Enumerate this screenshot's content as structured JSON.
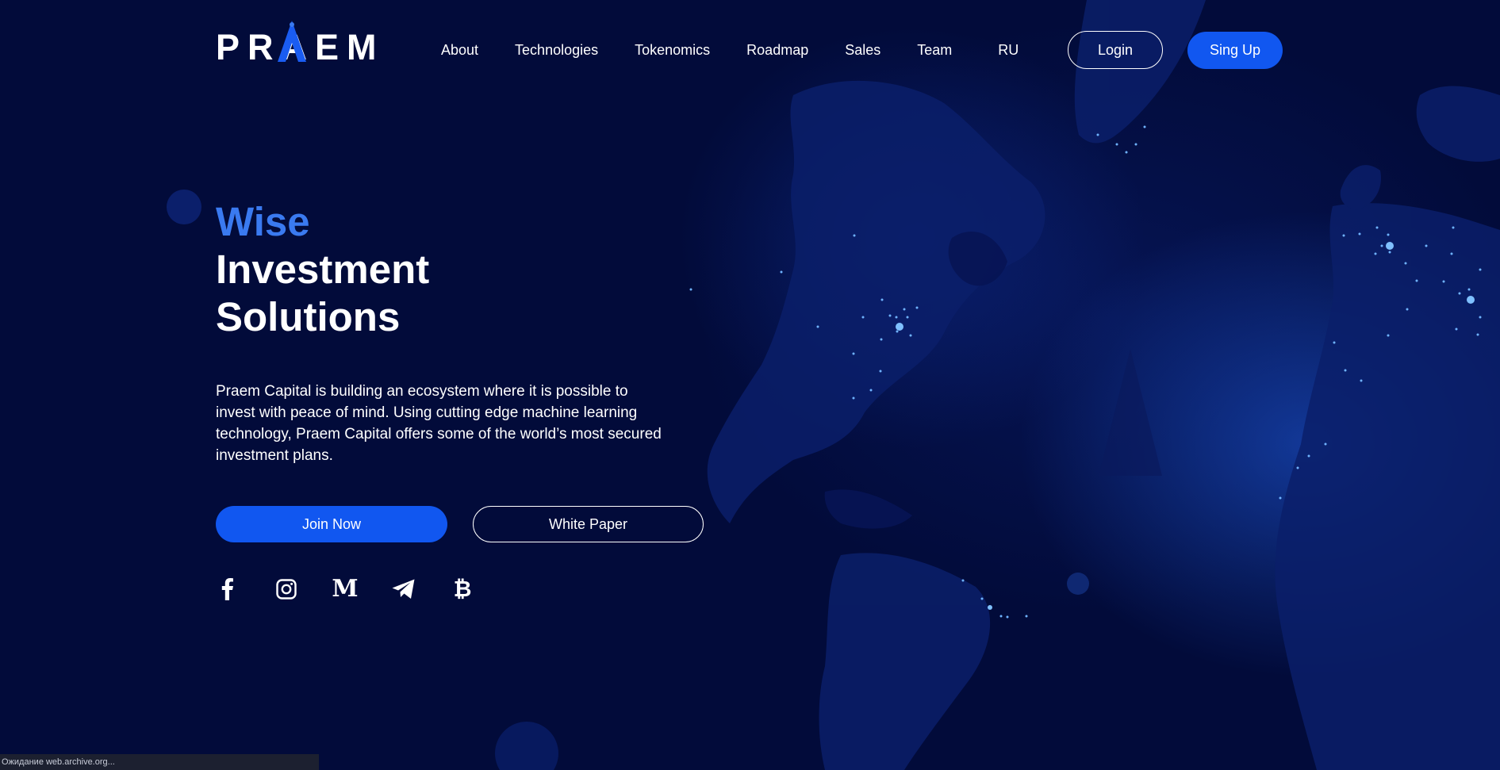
{
  "brand": {
    "logo_text": "PRAEM"
  },
  "nav": {
    "items": [
      "About",
      "Technologies",
      "Tokenomics",
      "Roadmap",
      "Sales",
      "Team"
    ],
    "language": "RU"
  },
  "header": {
    "login_label": "Login",
    "signup_label": "Sing Up"
  },
  "hero": {
    "title_accent": "Wise",
    "title_line2": "Investment",
    "title_line3": "Solutions",
    "description": "Praem Capital is building an ecosystem where it is possible to invest with peace of mind. Using cutting edge machine learning technology, Praem Capital offers some of the world’s most secured investment plans.",
    "join_label": "Join Now",
    "whitepaper_label": "White Paper"
  },
  "socials": [
    "facebook-icon",
    "instagram-icon",
    "medium-icon",
    "telegram-icon",
    "bitcoin-icon"
  ],
  "social_glyphs": {
    "medium": "M",
    "bitcoin": "₿"
  },
  "colors": {
    "background": "#020b3a",
    "accent": "#1157f0",
    "title_accent": "#3a7af0"
  },
  "status_bar": "Ожидание web.archive.org..."
}
